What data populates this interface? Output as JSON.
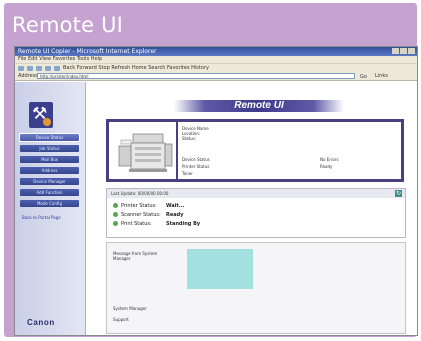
{
  "card": {
    "title": "Remote UI"
  },
  "browser": {
    "title": "Remote UI Copier - Microsoft Internet Explorer",
    "menu": "File  Edit  View  Favorites  Tools  Help",
    "toolbar": "Back  Forward  Stop  Refresh  Home  Search  Favorites  History",
    "address_label": "Address",
    "address_value": "http://printer/index.html",
    "go_label": "Go",
    "links_label": "Links"
  },
  "sidebar": {
    "nav_items": [
      {
        "label": "Device Status"
      },
      {
        "label": "Job Status"
      },
      {
        "label": "Mail Box"
      },
      {
        "label": "Address"
      },
      {
        "label": "Device Manager"
      },
      {
        "label": "Add Function"
      },
      {
        "label": "Mode Config"
      }
    ],
    "link_text": "Back to Portal Page",
    "brand": "Canon"
  },
  "main": {
    "banner": "Remote UI",
    "device": {
      "name_lines": [
        "Device Name",
        "Location:",
        "Status:"
      ],
      "rows": [
        {
          "label": "Device Status",
          "value": "No Errors"
        },
        {
          "label": "Printer Status",
          "value": "Ready"
        },
        {
          "label": "Toner",
          "value": ""
        }
      ]
    },
    "status": {
      "header": "Last Update: 00/00/00 00:00",
      "items": [
        {
          "label": "Printer Status:",
          "value": "Wait..."
        },
        {
          "label": "Scanner Status:",
          "value": "Ready"
        },
        {
          "label": "Print Status:",
          "value": "Standing By"
        }
      ]
    },
    "messages": {
      "label": "Message from System Manager",
      "manager_label": "System Manager",
      "manager_value": "Support"
    }
  },
  "colors": {
    "card": "#c6a2d0",
    "accent": "#48417f",
    "sidebar_button": "#4c60b0",
    "status_ok": "#58a550",
    "message_box": "#a3e1e1"
  }
}
